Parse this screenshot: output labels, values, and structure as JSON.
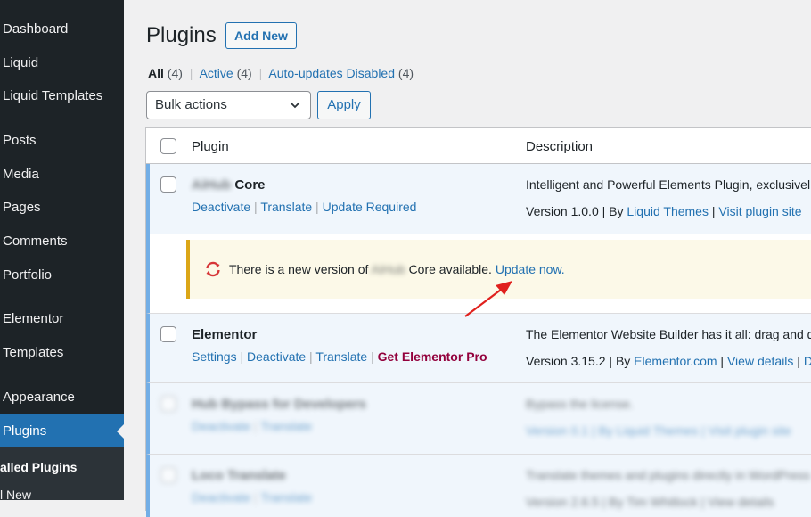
{
  "sidebar": {
    "items": [
      {
        "label": "Dashboard"
      },
      {
        "label": "Liquid"
      },
      {
        "label": "Liquid Templates"
      },
      {
        "label": "Posts"
      },
      {
        "label": "Media"
      },
      {
        "label": "Pages"
      },
      {
        "label": "Comments"
      },
      {
        "label": "Portfolio"
      },
      {
        "label": "Elementor"
      },
      {
        "label": "Templates"
      },
      {
        "label": "Appearance"
      },
      {
        "label": "Plugins"
      }
    ],
    "submenu": [
      {
        "label": "alled Plugins"
      },
      {
        "label": "l New"
      }
    ]
  },
  "page": {
    "title": "Plugins",
    "add_new": "Add New"
  },
  "filters": {
    "all": "All",
    "all_count": "(4)",
    "active": "Active",
    "active_count": "(4)",
    "auto": "Auto-updates Disabled",
    "auto_count": "(4)"
  },
  "toolbar": {
    "bulk": "Bulk actions",
    "apply": "Apply"
  },
  "table": {
    "col_plugin": "Plugin",
    "col_description": "Description",
    "rows": [
      {
        "name_blurred": "AiHub",
        "name": "Core",
        "actions": [
          "Deactivate",
          "Translate",
          "Update Required"
        ],
        "description": "Intelligent and Powerful Elements Plugin, exclusivel",
        "version": "Version 1.0.0",
        "by": "By",
        "author": "Liquid Themes",
        "site": "Visit plugin site"
      },
      {
        "name": "Elementor",
        "actions": [
          "Settings",
          "Deactivate",
          "Translate"
        ],
        "pro": "Get Elementor Pro",
        "description": "The Elementor Website Builder has it all: drag and d",
        "version": "Version 3.15.2",
        "by": "By",
        "author": "Elementor.com",
        "details": "View details",
        "trail": "D"
      },
      {
        "name": "Hub Bypass for Developers",
        "actions": [
          "Deactivate",
          "Translate"
        ],
        "description": "Bypass the license.",
        "meta": "Version 0.1 | By Liquid Themes | Visit plugin site"
      },
      {
        "name": "Loco Translate",
        "actions": [
          "Deactivate",
          "Translate"
        ],
        "description": "Translate themes and plugins directly in WordPress",
        "meta": "Version 2.6.5 | By Tim Whitlock | View details"
      }
    ]
  },
  "notice": {
    "prefix": "There is a new version of",
    "blurred": "AiHub",
    "suffix": "Core available.",
    "link": "Update now."
  },
  "colors": {
    "sidebar": "#1d2327",
    "accent": "#2271b1",
    "notice_border": "#dba617",
    "notice_bg": "#fcf9e8",
    "arrow": "#e0201c",
    "pro": "#93003c"
  }
}
